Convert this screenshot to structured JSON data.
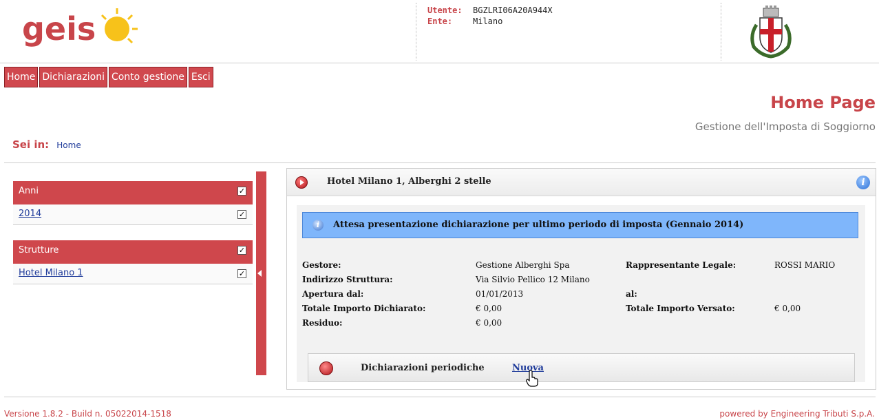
{
  "header": {
    "logo_text": "geis",
    "user_label": "Utente:",
    "user_value": "BGZLRI06A20A944X",
    "ente_label": "Ente:",
    "ente_value": "Milano"
  },
  "menu": {
    "items": [
      {
        "label": "Home"
      },
      {
        "label": "Dichiarazioni"
      },
      {
        "label": "Conto gestione"
      },
      {
        "label": "Esci"
      }
    ]
  },
  "title": {
    "main": "Home Page",
    "subtitle": "Gestione dell'Imposta di Soggiorno"
  },
  "breadcrumb": {
    "label": "Sei in:",
    "current": "Home"
  },
  "left_panel": {
    "groups": [
      {
        "header": "Anni",
        "checked": true,
        "items": [
          {
            "label": "2014",
            "checked": true
          }
        ]
      },
      {
        "header": "Strutture",
        "checked": true,
        "items": [
          {
            "label": "Hotel Milano 1",
            "checked": true
          }
        ]
      }
    ],
    "check_glyph": "✓"
  },
  "right_panel": {
    "title": "Hotel Milano 1, Alberghi 2 stelle",
    "info_glyph": "i",
    "alert_text": "Attesa presentazione dichiarazione per ultimo periodo di imposta (Gennaio 2014)",
    "details": {
      "gestore_label": "Gestore:",
      "gestore_value": "Gestione Alberghi Spa",
      "rappresentante_label": "Rappresentante Legale:",
      "rappresentante_value": "ROSSI MARIO",
      "indirizzo_label": "Indirizzo Struttura:",
      "indirizzo_value": "Via Silvio Pellico 12 Milano",
      "apertura_label": "Apertura dal:",
      "apertura_value": "01/01/2013",
      "al_label": "al:",
      "al_value": "",
      "totale_dichiarato_label": "Totale Importo Dichiarato:",
      "totale_dichiarato_value": "€ 0,00",
      "totale_versato_label": "Totale Importo Versato:",
      "totale_versato_value": "€ 0,00",
      "residuo_label": "Residuo:",
      "residuo_value": "€ 0,00"
    },
    "periodic": {
      "title": "Dichiarazioni periodiche",
      "link": "Nuova"
    }
  },
  "footer": {
    "version": "Versione 1.8.2 - Build n. 05022014-1518",
    "powered": "powered by Engineering Tributi S.p.A."
  },
  "colors": {
    "brand_red": "#cf474c",
    "alert_blue": "#7fb6fb",
    "link_blue": "#1f3b9a"
  }
}
